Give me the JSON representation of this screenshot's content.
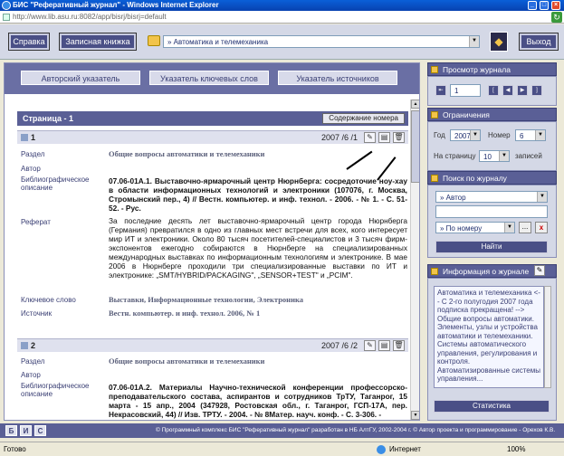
{
  "window": {
    "title": "БИС \"Реферативный журнал\" - Windows Internet Explorer",
    "address": "http://www.lib.asu.ru:8082/app/bisrj/bisrj=default"
  },
  "toolbar": {
    "help_label": "Справка",
    "notebook_label": "Записная книжка",
    "rubric_value": "» Автоматика и телемеханика",
    "exit_label": "Выход"
  },
  "tabs": [
    "Авторский указатель",
    "Указатель ключевых слов",
    "Указатель источников"
  ],
  "page": {
    "title": "Страница - 1",
    "contents_button": "Содержание номера"
  },
  "field_labels": {
    "section": "Раздел",
    "author": "Автор",
    "bib": "Библиографическое описание",
    "abstract": "Реферат",
    "keywords": "Ключевое слово",
    "source": "Источник"
  },
  "records": [
    {
      "num": "1",
      "date": "2007 /6 /1",
      "section": "Общие вопросы автоматики и телемеханики",
      "author": "",
      "bib": "07.06-01А.1. Выставочно-ярмарочный центр Нюрнберга: сосредоточие ноу-хау в области информационных технологий и электроники (107076, г. Москва, Стромынский пер., 4) // Вестн. компьютер. и инф. технол. - 2006. - № 1. - С. 51-52. - Рус.",
      "abstract": "За последние десять лет выставочно-ярмарочный центр города Нюрнберга (Германия) превратился в одно из главных мест встречи для всех, кого интересует мир ИТ и электроники. Около 80 тысяч посетителей-специалистов и 3 тысяч фирм-экспонентов ежегодно собираются в Нюрнберге на специализированных международных выставках по информационным технологиям и электронике. В мае 2006 в Нюрнберге проходили три специализированные выставки по ИТ и электронике: „SMT/HYBRID/PACKAGING\", „SENSOR+TEST\" и „PCIM\".",
      "keywords": "Выставки, Информационные технологии, Электроника",
      "source": "Вестн. компьютер. и инф. технол. 2006, № 1"
    },
    {
      "num": "2",
      "date": "2007 /6 /2",
      "section": "Общие вопросы автоматики и телемеханики",
      "author": "",
      "bib": "07.06-01А.2. Материалы Научно-технической конференции профессорско-преподавательского состава, аспирантов и сотрудников ТрТУ, Таганрог, 15 марта - 15 апр., 2004 (347928, Ростовская обл., г. Таганрог, ГСП-17А, пер. Некрасовский, 44) // Изв. ТРТУ. - 2004. - № 8Матер. науч. конф. - С. 3-306. -"
    }
  ],
  "journal_view": {
    "title": "Просмотр журнала",
    "page_value": "1"
  },
  "limits": {
    "title": "Ограничения",
    "year_label": "Год",
    "year_value": "2007",
    "number_label": "Номер",
    "number_value": "6",
    "per_page_label": "На страницу",
    "per_page_value": "10",
    "records_label": "записей"
  },
  "search": {
    "title": "Поиск по журналу",
    "field1": "» Автор",
    "field2": "» По номеру",
    "dots": "...",
    "clear": "x",
    "find_label": "Найти"
  },
  "info": {
    "title": "Информация о журнале",
    "text": "Автоматика и телемеханика <-- С 2-го полугодия 2007 года подписка прекращена! --> Общие вопросы автоматики. Элементы, узлы и устройства автоматики и телемеханики. Системы автоматического управления, регулирования и контроля. Автоматизированные системы управления...",
    "stats_label": "Статистика"
  },
  "footer": {
    "bis": [
      "Б",
      "И",
      "С"
    ],
    "text": "© Программный комплекс БИС \"Реферативный журнал\" разработан в НБ АлтГУ, 2002-2004 г. © Автор проекта и программирование - Орехов К.В."
  },
  "status": {
    "left": "Готово",
    "zone": "Интернет",
    "zoom": "100%"
  }
}
